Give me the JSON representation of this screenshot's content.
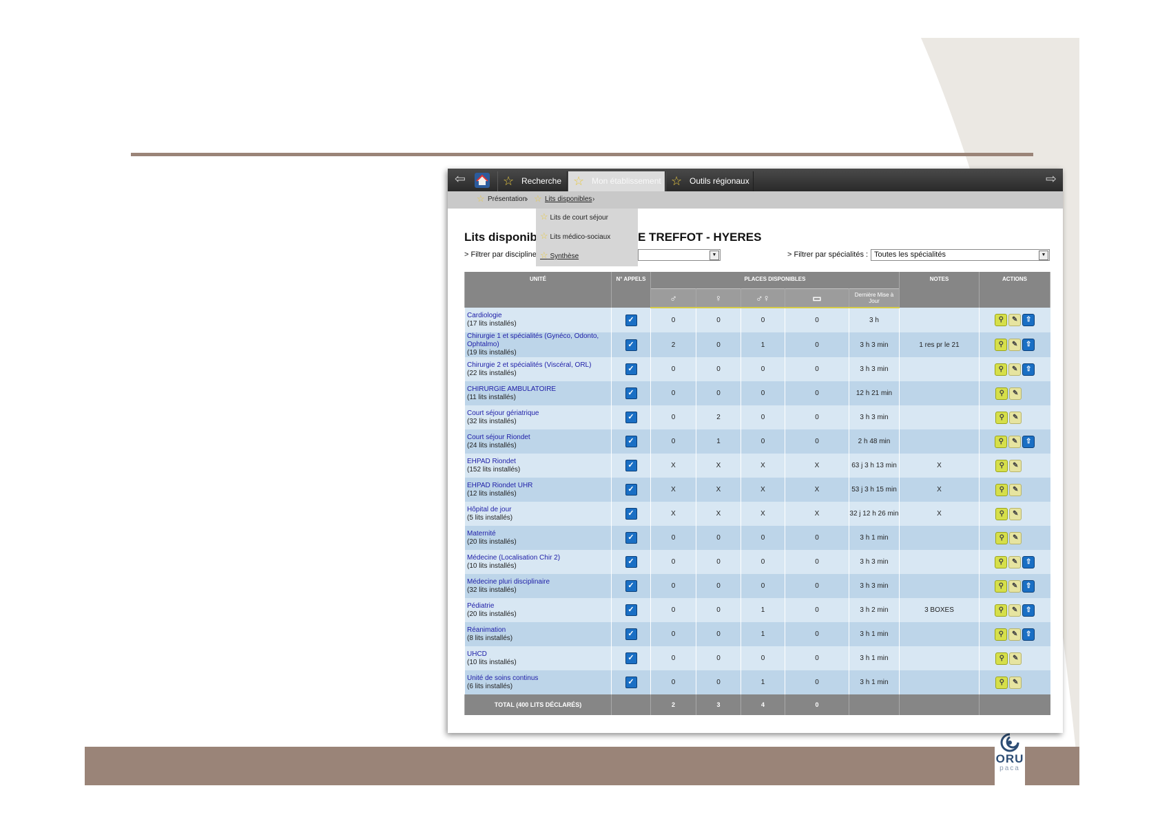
{
  "slide": {
    "logo_text": "ORU",
    "logo_sub": "paca",
    "accent_color": "#9a8478"
  },
  "nav": {
    "tabs": [
      {
        "label": "Recherche",
        "icon": "star-icon"
      },
      {
        "label": "Mon établissement",
        "icon": "star-icon",
        "active": true
      },
      {
        "label": "Outils régionaux",
        "icon": "star-icon"
      }
    ],
    "back_icon": "arrow-left-icon",
    "forward_icon": "arrow-right-icon",
    "home_icon": "home-icon"
  },
  "subnav": {
    "items": [
      {
        "label": "Présentation"
      },
      {
        "label": "Lits disponibles",
        "active": true
      }
    ],
    "separator": "›"
  },
  "dropdown": {
    "items": [
      {
        "label": "Lits de court séjour"
      },
      {
        "label": "Lits médico-sociaux"
      },
      {
        "label": "Synthèse"
      }
    ]
  },
  "page": {
    "title_left": "Lits disponibl",
    "title_right": "E TREFFOT - HYERES",
    "filter_discipline_label": "> Filtrer par discipline",
    "filter_specialite_label": "> Filtrer par spécialités :",
    "filter_specialite_value": "Toutes les spécialités"
  },
  "table": {
    "headers": {
      "unite": "UNITÉ",
      "appels": "N° APPELS",
      "places": "PLACES DISPONIBLES",
      "notes": "NOTES",
      "actions": "ACTIONS",
      "derniere_maj": "Dernière Mise à Jour"
    },
    "rows": [
      {
        "name": "Cardiologie",
        "beds": "(17 lits installés)",
        "v1": "0",
        "v2": "0",
        "v3": "0",
        "v4": "0",
        "maj": "3 h",
        "note": "",
        "up": true
      },
      {
        "name": "Chirurgie 1 et spécialités (Gynéco, Odonto, Ophtalmo)",
        "beds": "(19 lits installés)",
        "v1": "2",
        "v2": "0",
        "v3": "1",
        "v4": "0",
        "maj": "3 h 3 min",
        "note": "1 res pr le 21",
        "up": true
      },
      {
        "name": "Chirurgie 2 et spécialités (Viscéral, ORL)",
        "beds": "(22 lits installés)",
        "v1": "0",
        "v2": "0",
        "v3": "0",
        "v4": "0",
        "maj": "3 h 3 min",
        "note": "",
        "up": true
      },
      {
        "name": "CHIRURGIE AMBULATOIRE",
        "beds": "(11 lits installés)",
        "v1": "0",
        "v2": "0",
        "v3": "0",
        "v4": "0",
        "maj": "12 h 21 min",
        "note": "",
        "up": false
      },
      {
        "name": "Court séjour gériatrique",
        "beds": "(32 lits installés)",
        "v1": "0",
        "v2": "2",
        "v3": "0",
        "v4": "0",
        "maj": "3 h 3 min",
        "note": "",
        "up": false
      },
      {
        "name": "Court séjour Riondet",
        "beds": "(24 lits installés)",
        "v1": "0",
        "v2": "1",
        "v3": "0",
        "v4": "0",
        "maj": "2 h 48 min",
        "note": "",
        "up": true
      },
      {
        "name": "EHPAD Riondet",
        "beds": "(152 lits installés)",
        "v1": "X",
        "v2": "X",
        "v3": "X",
        "v4": "X",
        "maj": "63 j 3 h 13 min",
        "note": "X",
        "up": false
      },
      {
        "name": "EHPAD Riondet UHR",
        "beds": "(12 lits installés)",
        "v1": "X",
        "v2": "X",
        "v3": "X",
        "v4": "X",
        "maj": "53 j 3 h 15 min",
        "note": "X",
        "up": false
      },
      {
        "name": "Hôpital de jour",
        "beds": "(5 lits installés)",
        "v1": "X",
        "v2": "X",
        "v3": "X",
        "v4": "X",
        "maj": "32 j 12 h 26 min",
        "note": "X",
        "up": false
      },
      {
        "name": "Maternité",
        "beds": "(20 lits installés)",
        "v1": "0",
        "v2": "0",
        "v3": "0",
        "v4": "0",
        "maj": "3 h 1 min",
        "note": "",
        "up": false
      },
      {
        "name": "Médecine (Localisation Chir 2)",
        "beds": "(10 lits installés)",
        "v1": "0",
        "v2": "0",
        "v3": "0",
        "v4": "0",
        "maj": "3 h 3 min",
        "note": "",
        "up": true
      },
      {
        "name": "Médecine pluri disciplinaire",
        "beds": "(32 lits installés)",
        "v1": "0",
        "v2": "0",
        "v3": "0",
        "v4": "0",
        "maj": "3 h 3 min",
        "note": "",
        "up": true
      },
      {
        "name": "Pédiatrie",
        "beds": "(20 lits installés)",
        "v1": "0",
        "v2": "0",
        "v3": "1",
        "v4": "0",
        "maj": "3 h 2 min",
        "note": "3 BOXES",
        "up": true
      },
      {
        "name": "Réanimation",
        "beds": "(8 lits installés)",
        "v1": "0",
        "v2": "0",
        "v3": "1",
        "v4": "0",
        "maj": "3 h 1 min",
        "note": "",
        "up": true
      },
      {
        "name": "UHCD",
        "beds": "(10 lits installés)",
        "v1": "0",
        "v2": "0",
        "v3": "0",
        "v4": "0",
        "maj": "3 h 1 min",
        "note": "",
        "up": false
      },
      {
        "name": "Unité de soins continus",
        "beds": "(6 lits installés)",
        "v1": "0",
        "v2": "0",
        "v3": "1",
        "v4": "0",
        "maj": "3 h 1 min",
        "note": "",
        "up": false
      }
    ],
    "total": {
      "label": "TOTAL (400 LITS DÉCLARÉS)",
      "v1": "2",
      "v2": "3",
      "v3": "4",
      "v4": "0"
    }
  }
}
